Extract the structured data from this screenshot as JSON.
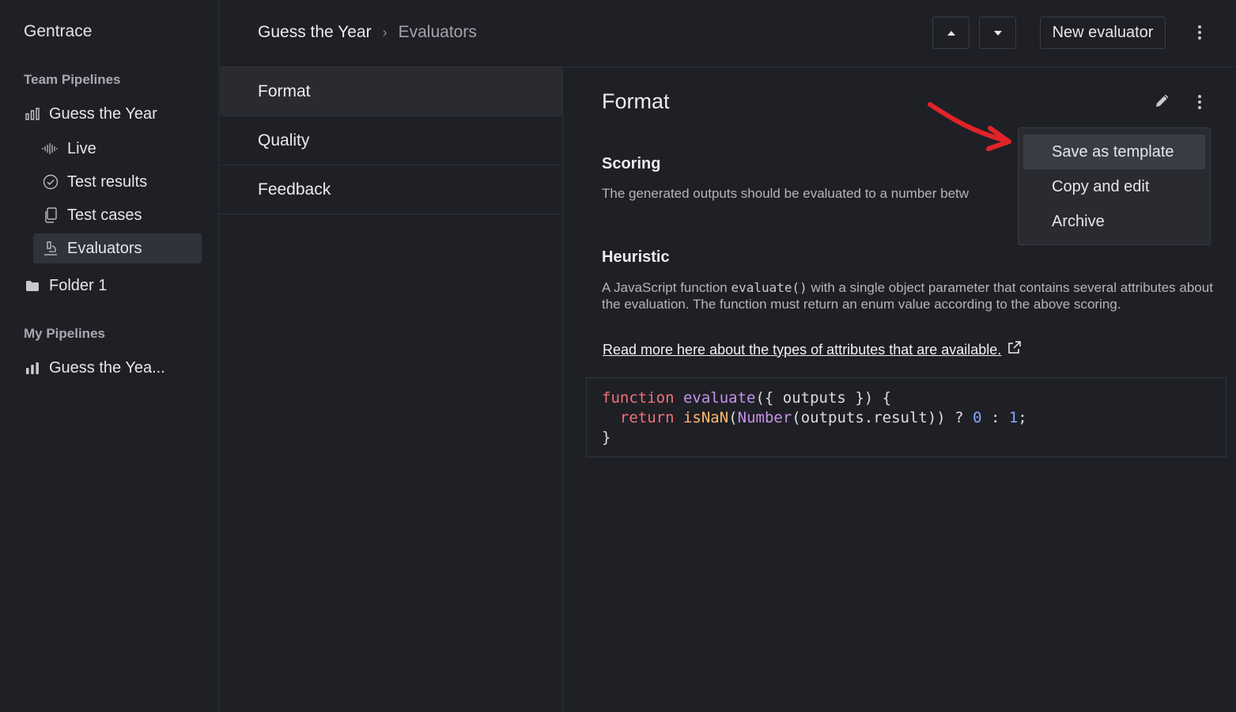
{
  "sidebar": {
    "brand": "Gentrace",
    "team_section": "Team Pipelines",
    "team_pipeline": "Guess the Year",
    "sub_items": [
      "Live",
      "Test results",
      "Test cases",
      "Evaluators"
    ],
    "folder": "Folder 1",
    "my_section": "My Pipelines",
    "my_pipeline": "Guess the Yea..."
  },
  "header": {
    "crumb_1": "Guess the Year",
    "crumb_sep": "›",
    "crumb_2": "Evaluators",
    "new_button": "New evaluator"
  },
  "list": {
    "items": [
      "Format",
      "Quality",
      "Feedback"
    ]
  },
  "detail": {
    "title": "Format",
    "scoring_heading": "Scoring",
    "scoring_text": "The generated outputs should be evaluated to a number betw",
    "heuristic_heading": "Heuristic",
    "heuristic_pre": "A JavaScript function ",
    "heuristic_code": "evaluate()",
    "heuristic_post": " with a single object parameter that contains several attributes about the evaluation. The function must return an enum value according to the above scoring.",
    "link_text": "Read more here about the types of attributes that are available.",
    "code_line_1": {
      "kw": "function",
      "fn": "evaluate",
      "rest": "({ outputs }) {"
    },
    "code_line_2": {
      "kw": "return",
      "fn": "isNaN",
      "open": "(",
      "num_fn": "Number",
      "rest": "(outputs.result)) ? ",
      "zero": "0",
      "colon": " : ",
      "one": "1",
      "end": ";"
    },
    "code_line_3": "}"
  },
  "menu": {
    "items": [
      "Save as template",
      "Copy and edit",
      "Archive"
    ]
  },
  "colors": {
    "background": "#1f2026",
    "annotation_arrow": "#e0242a",
    "keyword": "#f07178",
    "function": "#c792ea",
    "number": "#82aaff"
  }
}
